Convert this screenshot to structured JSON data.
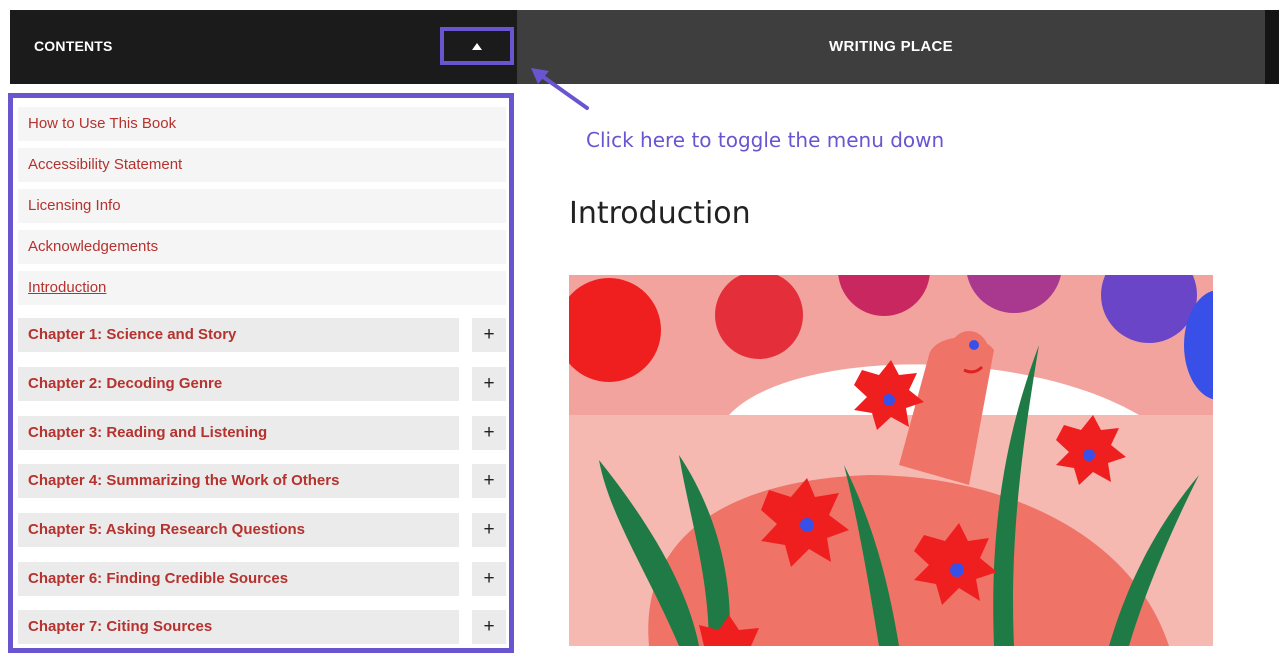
{
  "toc_header": {
    "title": "CONTENTS",
    "toggle_icon": "triangle-up-icon"
  },
  "book_header": {
    "title": "WRITING PLACE"
  },
  "annotation": {
    "hint_text": "Click here to toggle the menu down"
  },
  "toc": {
    "front_matter": [
      {
        "label": "How to Use This Book"
      },
      {
        "label": "Accessibility Statement"
      },
      {
        "label": "Licensing Info"
      },
      {
        "label": "Acknowledgements"
      },
      {
        "label": "Introduction",
        "current": true
      }
    ],
    "chapters": [
      {
        "label": "Chapter 1: Science and Story",
        "expand": "+"
      },
      {
        "label": "Chapter 2: Decoding Genre",
        "expand": "+"
      },
      {
        "label": "Chapter 3: Reading and Listening",
        "expand": "+"
      },
      {
        "label": "Chapter 4: Summarizing the Work of Others",
        "expand": "+"
      },
      {
        "label": "Chapter 5: Asking Research Questions",
        "expand": "+"
      },
      {
        "label": "Chapter 6: Finding Credible Sources",
        "expand": "+"
      },
      {
        "label": "Chapter 7: Citing Sources",
        "expand": "+"
      }
    ]
  },
  "main": {
    "heading": "Introduction"
  },
  "colors": {
    "accent_purple": "#6a55d0",
    "link_red": "#b5322e",
    "header_dark": "#1b1b1b",
    "header_gray": "#3e3e3e"
  }
}
